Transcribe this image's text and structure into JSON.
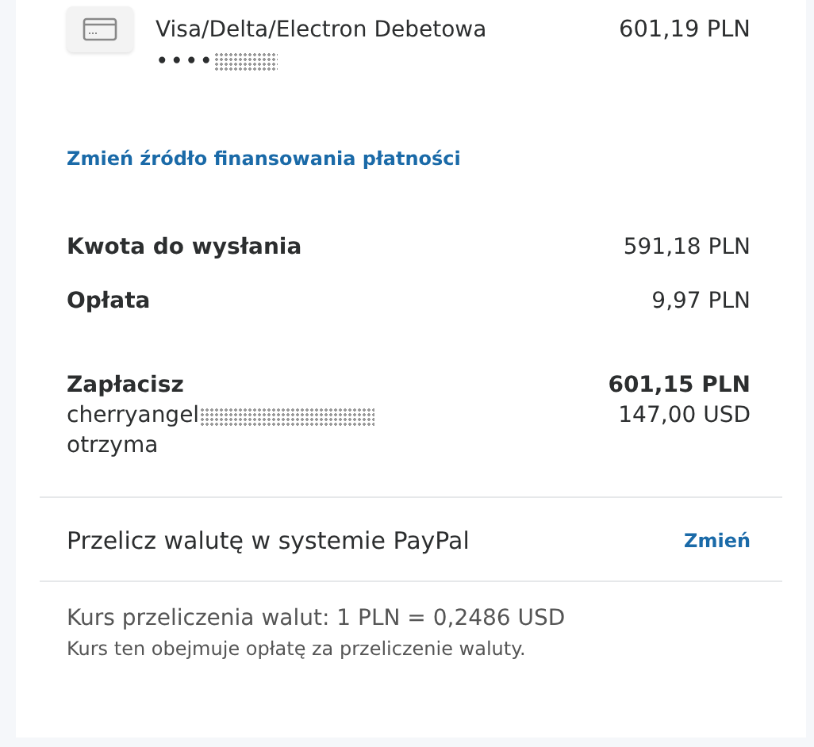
{
  "funding": {
    "name": "Visa/Delta/Electron Debetowa",
    "masked_number": "••••",
    "amount": "601,19 PLN"
  },
  "change_funding_link": "Zmień źródło finansowania płatności",
  "summary": [
    {
      "label": "Kwota do wysłania",
      "amount": "591,18 PLN"
    },
    {
      "label": "Opłata",
      "amount": "9,97 PLN"
    }
  ],
  "total": {
    "label": "Zapłacisz",
    "amount": "601,15 PLN",
    "recipient": "cherryangel",
    "recipient_suffix": "otrzyma",
    "received": "147,00 USD"
  },
  "conversion": {
    "label": "Przelicz walutę w systemie PayPal",
    "link": "Zmień"
  },
  "rate": {
    "text": "Kurs przeliczenia walut: 1 PLN = 0,2486 USD",
    "note": "Kurs ten obejmuje opłatę za przeliczenie waluty."
  }
}
